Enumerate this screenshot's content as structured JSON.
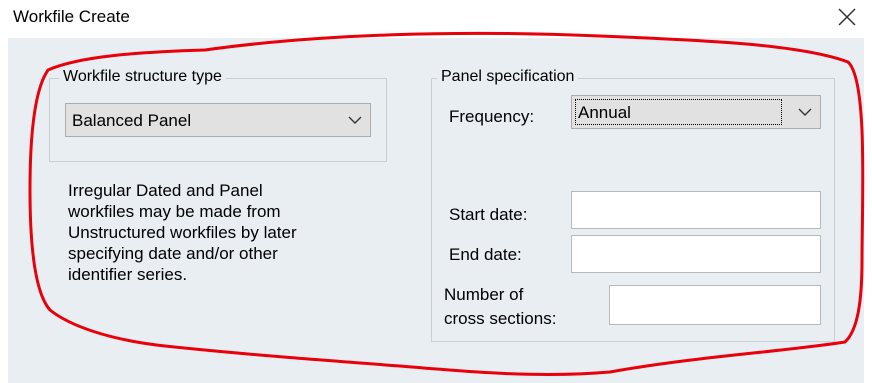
{
  "window": {
    "title": "Workfile Create"
  },
  "structure": {
    "legend": "Workfile structure type",
    "selected": "Balanced Panel"
  },
  "note": {
    "lines": [
      "Irregular Dated and Panel",
      "workfiles may be made from",
      "Unstructured workfiles by later",
      "specifying date and/or other",
      "identifier series."
    ]
  },
  "panel": {
    "legend": "Panel specification",
    "frequency_label": "Frequency:",
    "frequency_value": "Annual",
    "start_label": "Start date:",
    "start_value": "",
    "end_label": "End date:",
    "end_value": "",
    "cross_label_1": "Number of",
    "cross_label_2": "cross sections:",
    "cross_value": ""
  },
  "colors": {
    "annotation": "#e8000b",
    "dialog_bg": "#e8eef2"
  },
  "icons": {
    "close": "close-icon",
    "dropdown": "chevron-down-icon"
  }
}
